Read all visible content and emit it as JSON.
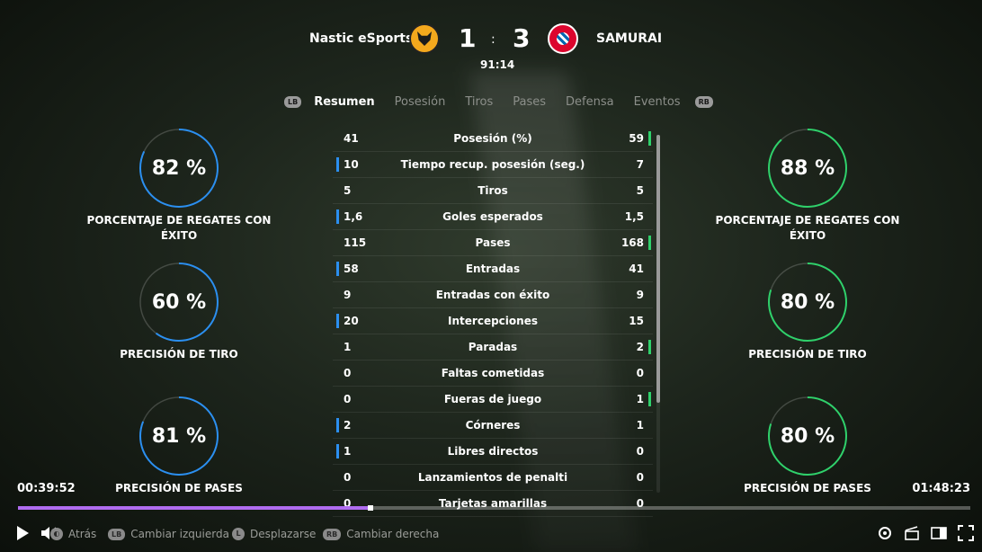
{
  "header": {
    "home_team": "Nastic eSports",
    "away_team": "SAMURAI",
    "home_score": "1",
    "separator": ":",
    "away_score": "3",
    "match_time": "91:14"
  },
  "tabs": {
    "left_button": "LB",
    "right_button": "RB",
    "items": [
      "Resumen",
      "Posesión",
      "Tiros",
      "Pases",
      "Defensa",
      "Eventos"
    ],
    "active": "Resumen"
  },
  "left_gauges": [
    {
      "value": 82,
      "display": "82 %",
      "label_line1": "PORCENTAJE DE REGATES CON",
      "label_line2": "ÉXITO",
      "color": "#2b8ff0"
    },
    {
      "value": 60,
      "display": "60 %",
      "label_line1": "PRECISIÓN DE TIRO",
      "label_line2": "",
      "color": "#2b8ff0"
    },
    {
      "value": 81,
      "display": "81 %",
      "label_line1": "PRECISIÓN DE PASES",
      "label_line2": "",
      "color": "#2b8ff0"
    }
  ],
  "right_gauges": [
    {
      "value": 88,
      "display": "88 %",
      "label_line1": "PORCENTAJE DE REGATES CON",
      "label_line2": "ÉXITO",
      "color": "#2fd16b"
    },
    {
      "value": 80,
      "display": "80 %",
      "label_line1": "PRECISIÓN DE TIRO",
      "label_line2": "",
      "color": "#2fd16b"
    },
    {
      "value": 80,
      "display": "80 %",
      "label_line1": "PRECISIÓN DE PASES",
      "label_line2": "",
      "color": "#2fd16b"
    }
  ],
  "stats": [
    {
      "home": "41",
      "name": "Posesión (%)",
      "away": "59",
      "leader": "away"
    },
    {
      "home": "10",
      "name": "Tiempo recup. posesión (seg.)",
      "away": "7",
      "leader": "home"
    },
    {
      "home": "5",
      "name": "Tiros",
      "away": "5",
      "leader": ""
    },
    {
      "home": "1,6",
      "name": "Goles esperados",
      "away": "1,5",
      "leader": "home"
    },
    {
      "home": "115",
      "name": "Pases",
      "away": "168",
      "leader": "away"
    },
    {
      "home": "58",
      "name": "Entradas",
      "away": "41",
      "leader": "home"
    },
    {
      "home": "9",
      "name": "Entradas con éxito",
      "away": "9",
      "leader": ""
    },
    {
      "home": "20",
      "name": "Intercepciones",
      "away": "15",
      "leader": "home"
    },
    {
      "home": "1",
      "name": "Paradas",
      "away": "2",
      "leader": "away"
    },
    {
      "home": "0",
      "name": "Faltas cometidas",
      "away": "0",
      "leader": ""
    },
    {
      "home": "0",
      "name": "Fueras de juego",
      "away": "1",
      "leader": "away"
    },
    {
      "home": "2",
      "name": "Córneres",
      "away": "1",
      "leader": "home"
    },
    {
      "home": "1",
      "name": "Libres directos",
      "away": "0",
      "leader": "home"
    },
    {
      "home": "0",
      "name": "Lanzamientos de penalti",
      "away": "0",
      "leader": ""
    },
    {
      "home": "0",
      "name": "Tarjetas amarillas",
      "away": "0",
      "leader": ""
    }
  ],
  "player": {
    "current_time": "00:39:52",
    "total_time": "01:48:23",
    "progress": 0.37
  },
  "hints": {
    "back_label": "Atrás",
    "switch_left_key": "LB",
    "switch_left": "Cambiar izquierda",
    "scroll_key": "L",
    "scroll": "Desplazarse",
    "switch_right_key": "RB",
    "switch_right": "Cambiar derecha"
  },
  "colors": {
    "home": "#2b8ff0",
    "away": "#2fd16b",
    "progress": "#b06cf0"
  }
}
